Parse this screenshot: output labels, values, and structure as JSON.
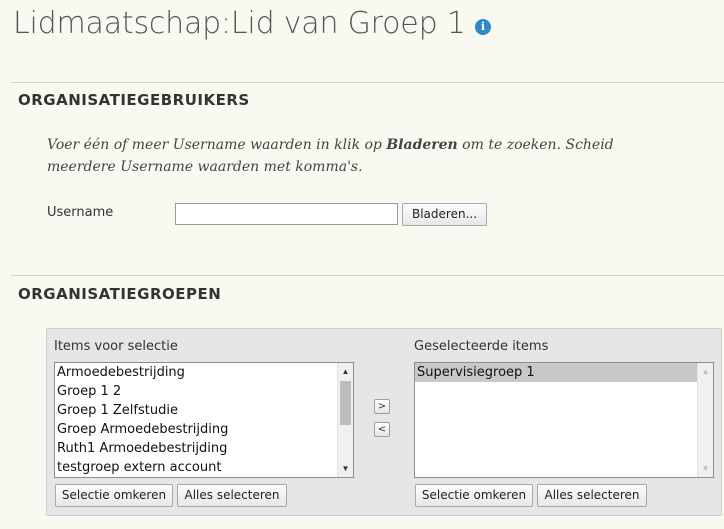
{
  "page": {
    "title": "Lidmaatschap:Lid van Groep 1",
    "info_icon_glyph": "i"
  },
  "users_section": {
    "heading": "ORGANISATIEGEBRUIKERS",
    "instructions_part1": "Voer één of meer Username waarden in klik op ",
    "instructions_bold": "Bladeren",
    "instructions_part2": " om te zoeken. Scheid meerdere Username waarden met komma's.",
    "username_label": "Username",
    "username_value": "",
    "browse_button": "Bladeren..."
  },
  "groups_section": {
    "heading": "ORGANISATIEGROEPEN",
    "available": {
      "label": "Items voor selectie",
      "items": [
        "Armoedebestrijding",
        "Groep 1 2",
        "Groep 1 Zelfstudie",
        "Groep Armoedebestrijding",
        "Ruth1 Armoedebestrijding",
        "testgroep extern account"
      ],
      "invert_button": "Selectie omkeren",
      "select_all_button": "Alles selecteren"
    },
    "move_right_glyph": ">",
    "move_left_glyph": "<",
    "selected": {
      "label": "Geselecteerde items",
      "items": [
        "Supervisiegroep 1"
      ],
      "invert_button": "Selectie omkeren",
      "select_all_button": "Alles selecteren"
    }
  },
  "colors": {
    "background": "#f9f8f1",
    "accent": "#2c8ac8",
    "panel": "#e6e6e6"
  }
}
